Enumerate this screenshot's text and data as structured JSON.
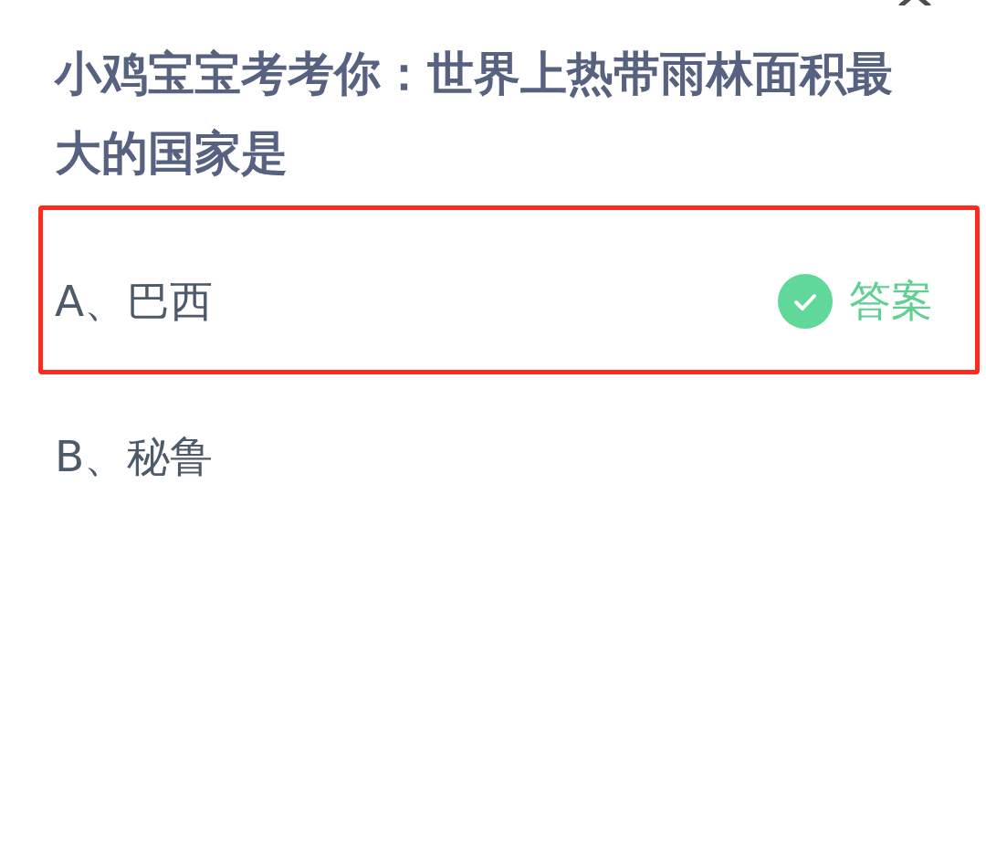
{
  "question": "小鸡宝宝考考你：世界上热带雨林面积最大的国家是",
  "options": [
    {
      "label": "A、巴西",
      "highlighted": true,
      "correct": true,
      "answer_tag": "答案"
    },
    {
      "label": "B、秘鲁",
      "highlighted": false,
      "correct": false
    }
  ]
}
